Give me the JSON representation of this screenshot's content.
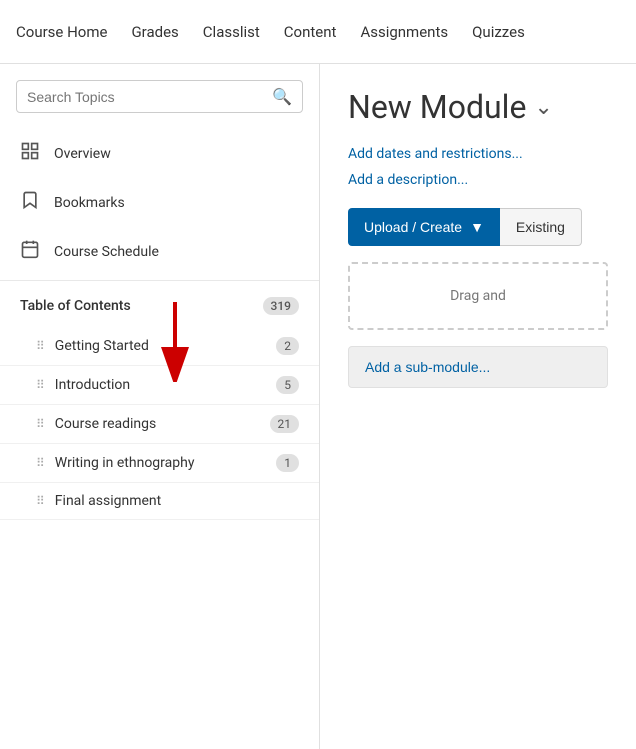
{
  "nav": {
    "items": [
      {
        "label": "Course Home",
        "id": "course-home"
      },
      {
        "label": "Grades",
        "id": "grades"
      },
      {
        "label": "Classlist",
        "id": "classlist"
      },
      {
        "label": "Content",
        "id": "content"
      },
      {
        "label": "Assignments",
        "id": "assignments"
      },
      {
        "label": "Quizzes",
        "id": "quizzes"
      }
    ]
  },
  "sidebar": {
    "search_placeholder": "Search Topics",
    "nav_items": [
      {
        "label": "Overview",
        "icon": "overview"
      },
      {
        "label": "Bookmarks",
        "icon": "bookmarks"
      },
      {
        "label": "Course Schedule",
        "icon": "schedule"
      }
    ],
    "toc": {
      "label": "Table of Contents",
      "badge": "319",
      "items": [
        {
          "label": "Getting Started",
          "badge": "2"
        },
        {
          "label": "Introduction",
          "badge": "5"
        },
        {
          "label": "Course readings",
          "badge": "21"
        },
        {
          "label": "Writing in ethnography",
          "badge": "1"
        },
        {
          "label": "Final assignment",
          "badge": ""
        }
      ]
    }
  },
  "main": {
    "module_title": "New Module",
    "add_dates_label": "Add dates and restrictions...",
    "add_description_label": "Add a description...",
    "upload_create_label": "Upload / Create",
    "existing_label": "Existing",
    "drag_drop_label": "Drag and",
    "add_submodule_label": "Add a sub-module..."
  }
}
